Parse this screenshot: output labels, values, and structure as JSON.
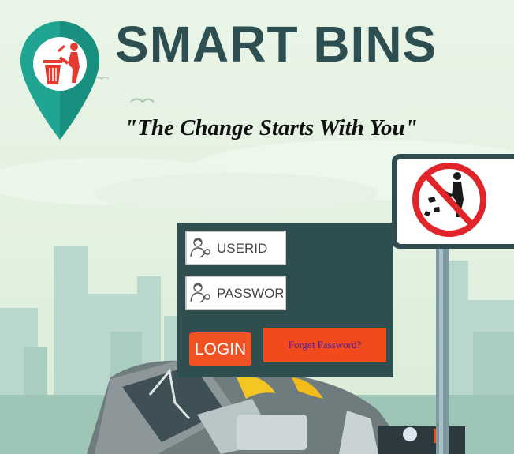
{
  "brand": {
    "title": "SMART BINS",
    "tagline": "\"The Change Starts With You\"",
    "primary_color": "#2d4f52",
    "accent_color": "#f05223"
  },
  "icons": {
    "logo": "location-pin-trash-icon",
    "sign": "no-littering-sign-icon",
    "field": "user-key-icon"
  },
  "login": {
    "userid_placeholder": "USERID",
    "password_placeholder": "PASSWORD",
    "login_label": "LOGIN",
    "forgot_label": "Forget Password?",
    "panel_color": "#2e4e4f"
  }
}
